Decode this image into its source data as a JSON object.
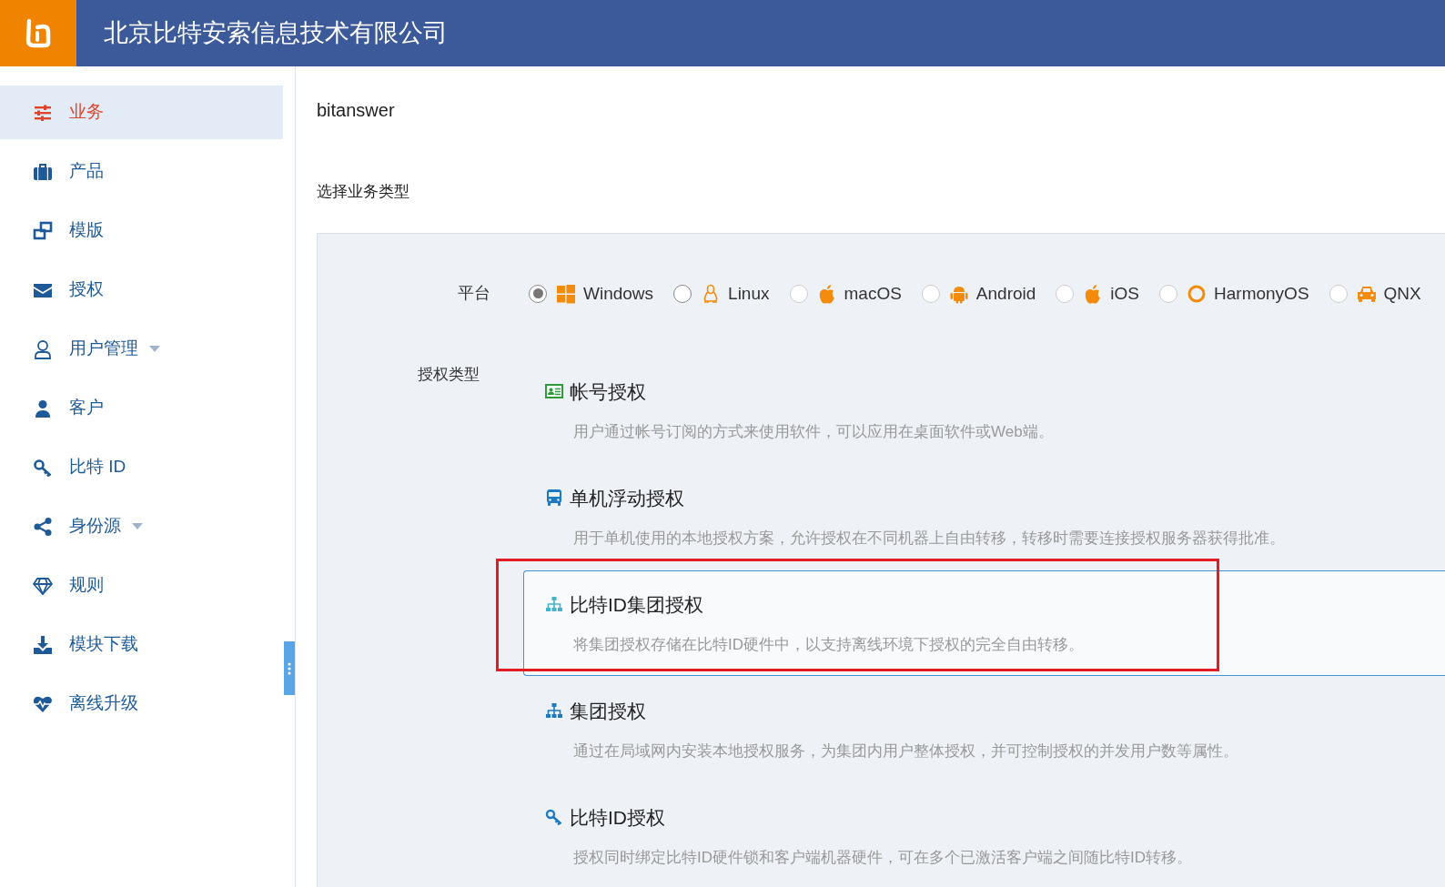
{
  "header": {
    "title": "北京比特安索信息技术有限公司"
  },
  "sidebar": {
    "items": [
      {
        "label": "业务",
        "selected": true,
        "expandable": false
      },
      {
        "label": "产品",
        "selected": false,
        "expandable": false
      },
      {
        "label": "模版",
        "selected": false,
        "expandable": false
      },
      {
        "label": "授权",
        "selected": false,
        "expandable": false
      },
      {
        "label": "用户管理",
        "selected": false,
        "expandable": true
      },
      {
        "label": "客户",
        "selected": false,
        "expandable": false
      },
      {
        "label": "比特 ID",
        "selected": false,
        "expandable": false
      },
      {
        "label": "身份源",
        "selected": false,
        "expandable": true
      },
      {
        "label": "规则",
        "selected": false,
        "expandable": false
      },
      {
        "label": "模块下载",
        "selected": false,
        "expandable": false
      },
      {
        "label": "离线升级",
        "selected": false,
        "expandable": false
      }
    ]
  },
  "main": {
    "title": "bitanswer",
    "section_label": "选择业务类型",
    "platform": {
      "label": "平台",
      "options": [
        {
          "label": "Windows",
          "selected": true,
          "disabled": false
        },
        {
          "label": "Linux",
          "selected": false,
          "disabled": false
        },
        {
          "label": "macOS",
          "selected": false,
          "disabled": true
        },
        {
          "label": "Android",
          "selected": false,
          "disabled": true
        },
        {
          "label": "iOS",
          "selected": false,
          "disabled": true
        },
        {
          "label": "HarmonyOS",
          "selected": false,
          "disabled": true
        },
        {
          "label": "QNX",
          "selected": false,
          "disabled": true
        }
      ]
    },
    "license_type": {
      "label": "授权类型",
      "options": [
        {
          "title": "帐号授权",
          "description": "用户通过帐号订阅的方式来使用软件，可以应用在桌面软件或Web端。",
          "selected": false,
          "highlighted": false
        },
        {
          "title": "单机浮动授权",
          "description": "用于单机使用的本地授权方案，允许授权在不同机器上自由转移，转移时需要连接授权服务器获得批准。",
          "selected": false,
          "highlighted": false
        },
        {
          "title": "比特ID集团授权",
          "description": "将集团授权存储在比特ID硬件中，以支持离线环境下授权的完全自由转移。",
          "selected": true,
          "highlighted": true
        },
        {
          "title": "集团授权",
          "description": "通过在局域网内安装本地授权服务，为集团内用户整体授权，并可控制授权的并发用户数等属性。",
          "selected": false,
          "highlighted": false
        },
        {
          "title": "比特ID授权",
          "description": "授权同时绑定比特ID硬件锁和客户端机器硬件，可在多个已激活客户端之间随比特ID转移。",
          "selected": false,
          "highlighted": false
        }
      ]
    }
  }
}
